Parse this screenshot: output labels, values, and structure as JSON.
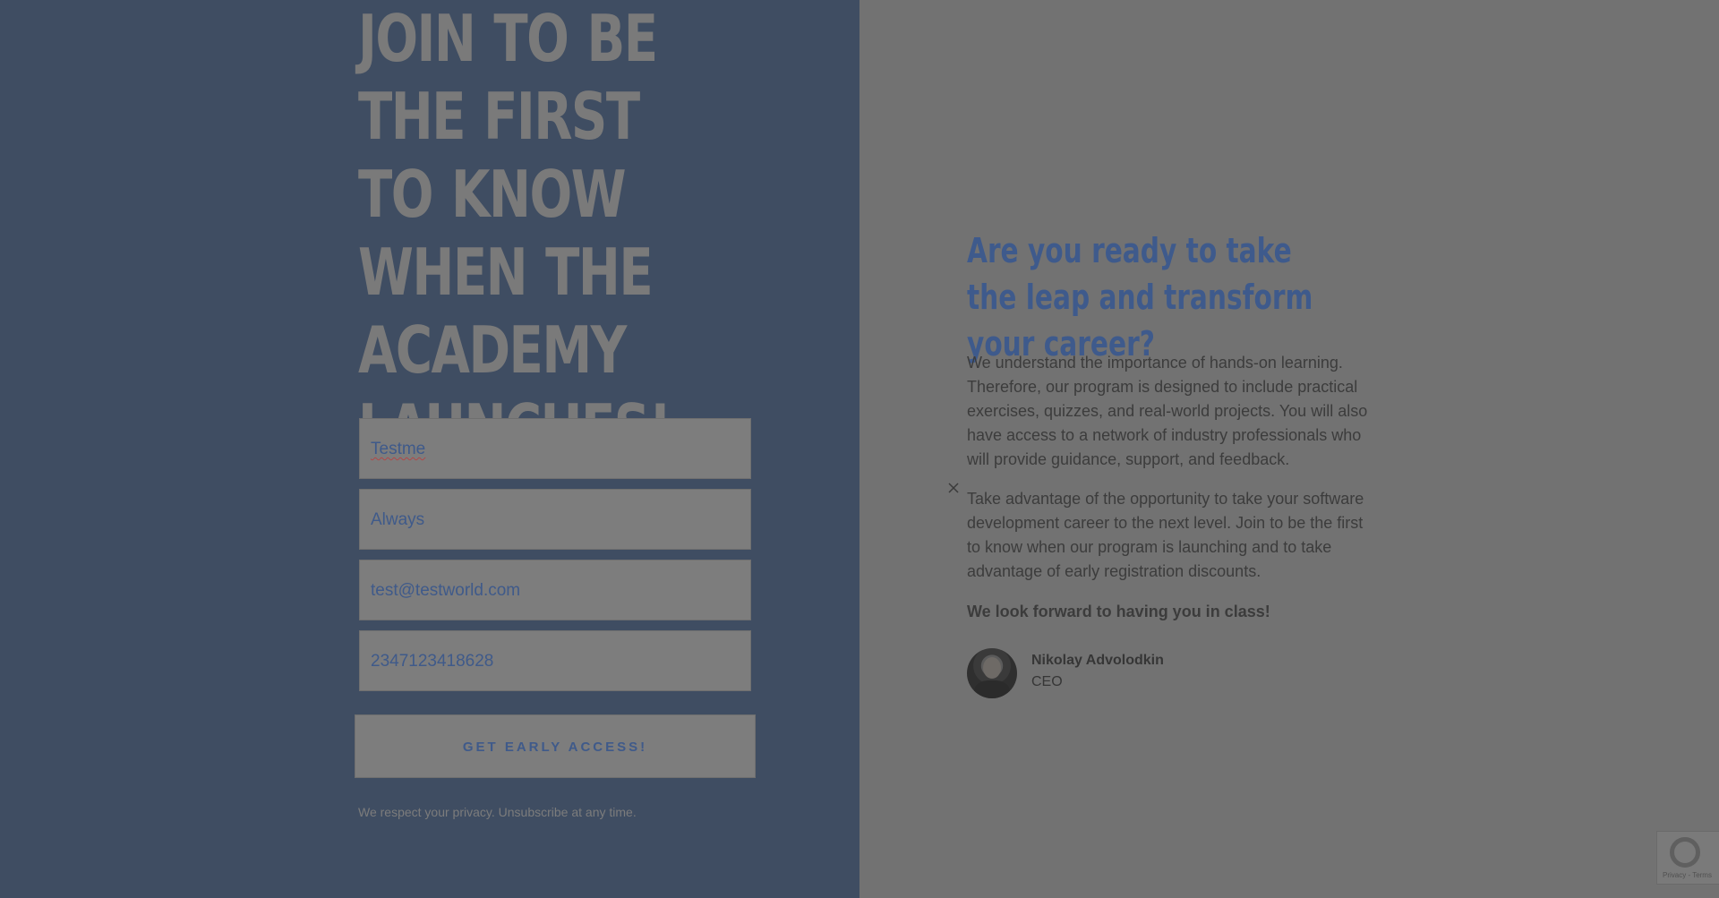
{
  "left": {
    "headline": "JOIN TO BE THE FIRST TO KNOW WHEN THE ACADEMY LAUNCHES!",
    "form": {
      "first_name_value": "Testme",
      "last_name_value": "Always",
      "email_value": "test@testworld.com",
      "phone_value": "2347123418628",
      "submit_label": "GET EARLY ACCESS!"
    },
    "privacy_note": "We respect your privacy. Unsubscribe at any time."
  },
  "right": {
    "close_icon": "close-icon",
    "title": "Are you ready to take the leap and transform your career?",
    "paragraph_1": "We understand the importance of hands-on learning. Therefore, our program is designed to include practical exercises, quizzes, and real-world projects. You will also have access to a network of industry professionals who will provide guidance, support, and feedback.",
    "paragraph_2": "Take advantage of the opportunity to take your software development career to the next level. Join to be the first to know when our program is launching and to take advantage of early registration discounts.",
    "closing": "We look forward to having you in class!",
    "person": {
      "name": "Nikolay Advolodkin",
      "role": "CEO"
    }
  },
  "recaptcha": {
    "text": "Privacy - Terms"
  },
  "colors": {
    "left_bg": "#3f4d62",
    "right_bg": "#727272",
    "accent": "#3e5a8c"
  }
}
